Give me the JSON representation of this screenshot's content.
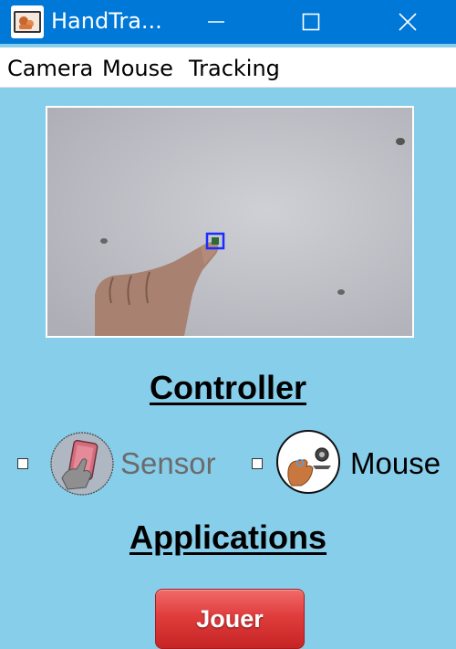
{
  "window": {
    "title": "HandTra...",
    "accent_color": "#0078D7",
    "icons": [
      "app-icon",
      "minimize-icon",
      "maximize-icon",
      "close-icon"
    ]
  },
  "menu": {
    "items": [
      {
        "label": "Camera"
      },
      {
        "label": "Mouse"
      },
      {
        "label": "Tracking"
      }
    ]
  },
  "camera": {
    "content": "live-hand-tracking-feed",
    "tracker_color": "#1a2cff"
  },
  "controller": {
    "title": "Controller",
    "options": [
      {
        "label": "Sensor",
        "checked": false,
        "enabled": false,
        "icon": "hand-sensor-icon"
      },
      {
        "label": "Mouse",
        "checked": false,
        "enabled": true,
        "icon": "webcam-hand-icon"
      }
    ]
  },
  "applications": {
    "title": "Applications",
    "play_label": "Jouer",
    "play_color": "#e03c3c"
  },
  "background_color": "#87CEEB"
}
